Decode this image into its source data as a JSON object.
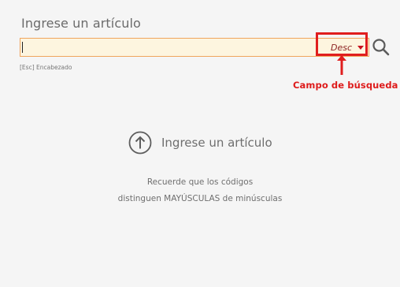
{
  "panel": {
    "title": "Ingrese un artículo"
  },
  "search": {
    "value": "",
    "sort_label": "Desc",
    "hint": "[Esc]  Encabezado"
  },
  "annotation": {
    "label": "Campo de búsqueda",
    "color": "#de1b1b"
  },
  "empty_state": {
    "title": "Ingrese un artículo",
    "note_line_1": "Recuerde que los códigos",
    "note_line_2": "distinguen MAYÚSCULAS de minúsculas"
  },
  "colors": {
    "input_border": "#f0a55d",
    "input_background": "#fdf5df",
    "sort_text": "#8b1f1f",
    "dropdown_arrow": "#c8101d"
  },
  "icons": {
    "search": "search-icon",
    "dropdown": "chevron-down-icon",
    "empty_state": "arrow-up-circle-icon"
  }
}
